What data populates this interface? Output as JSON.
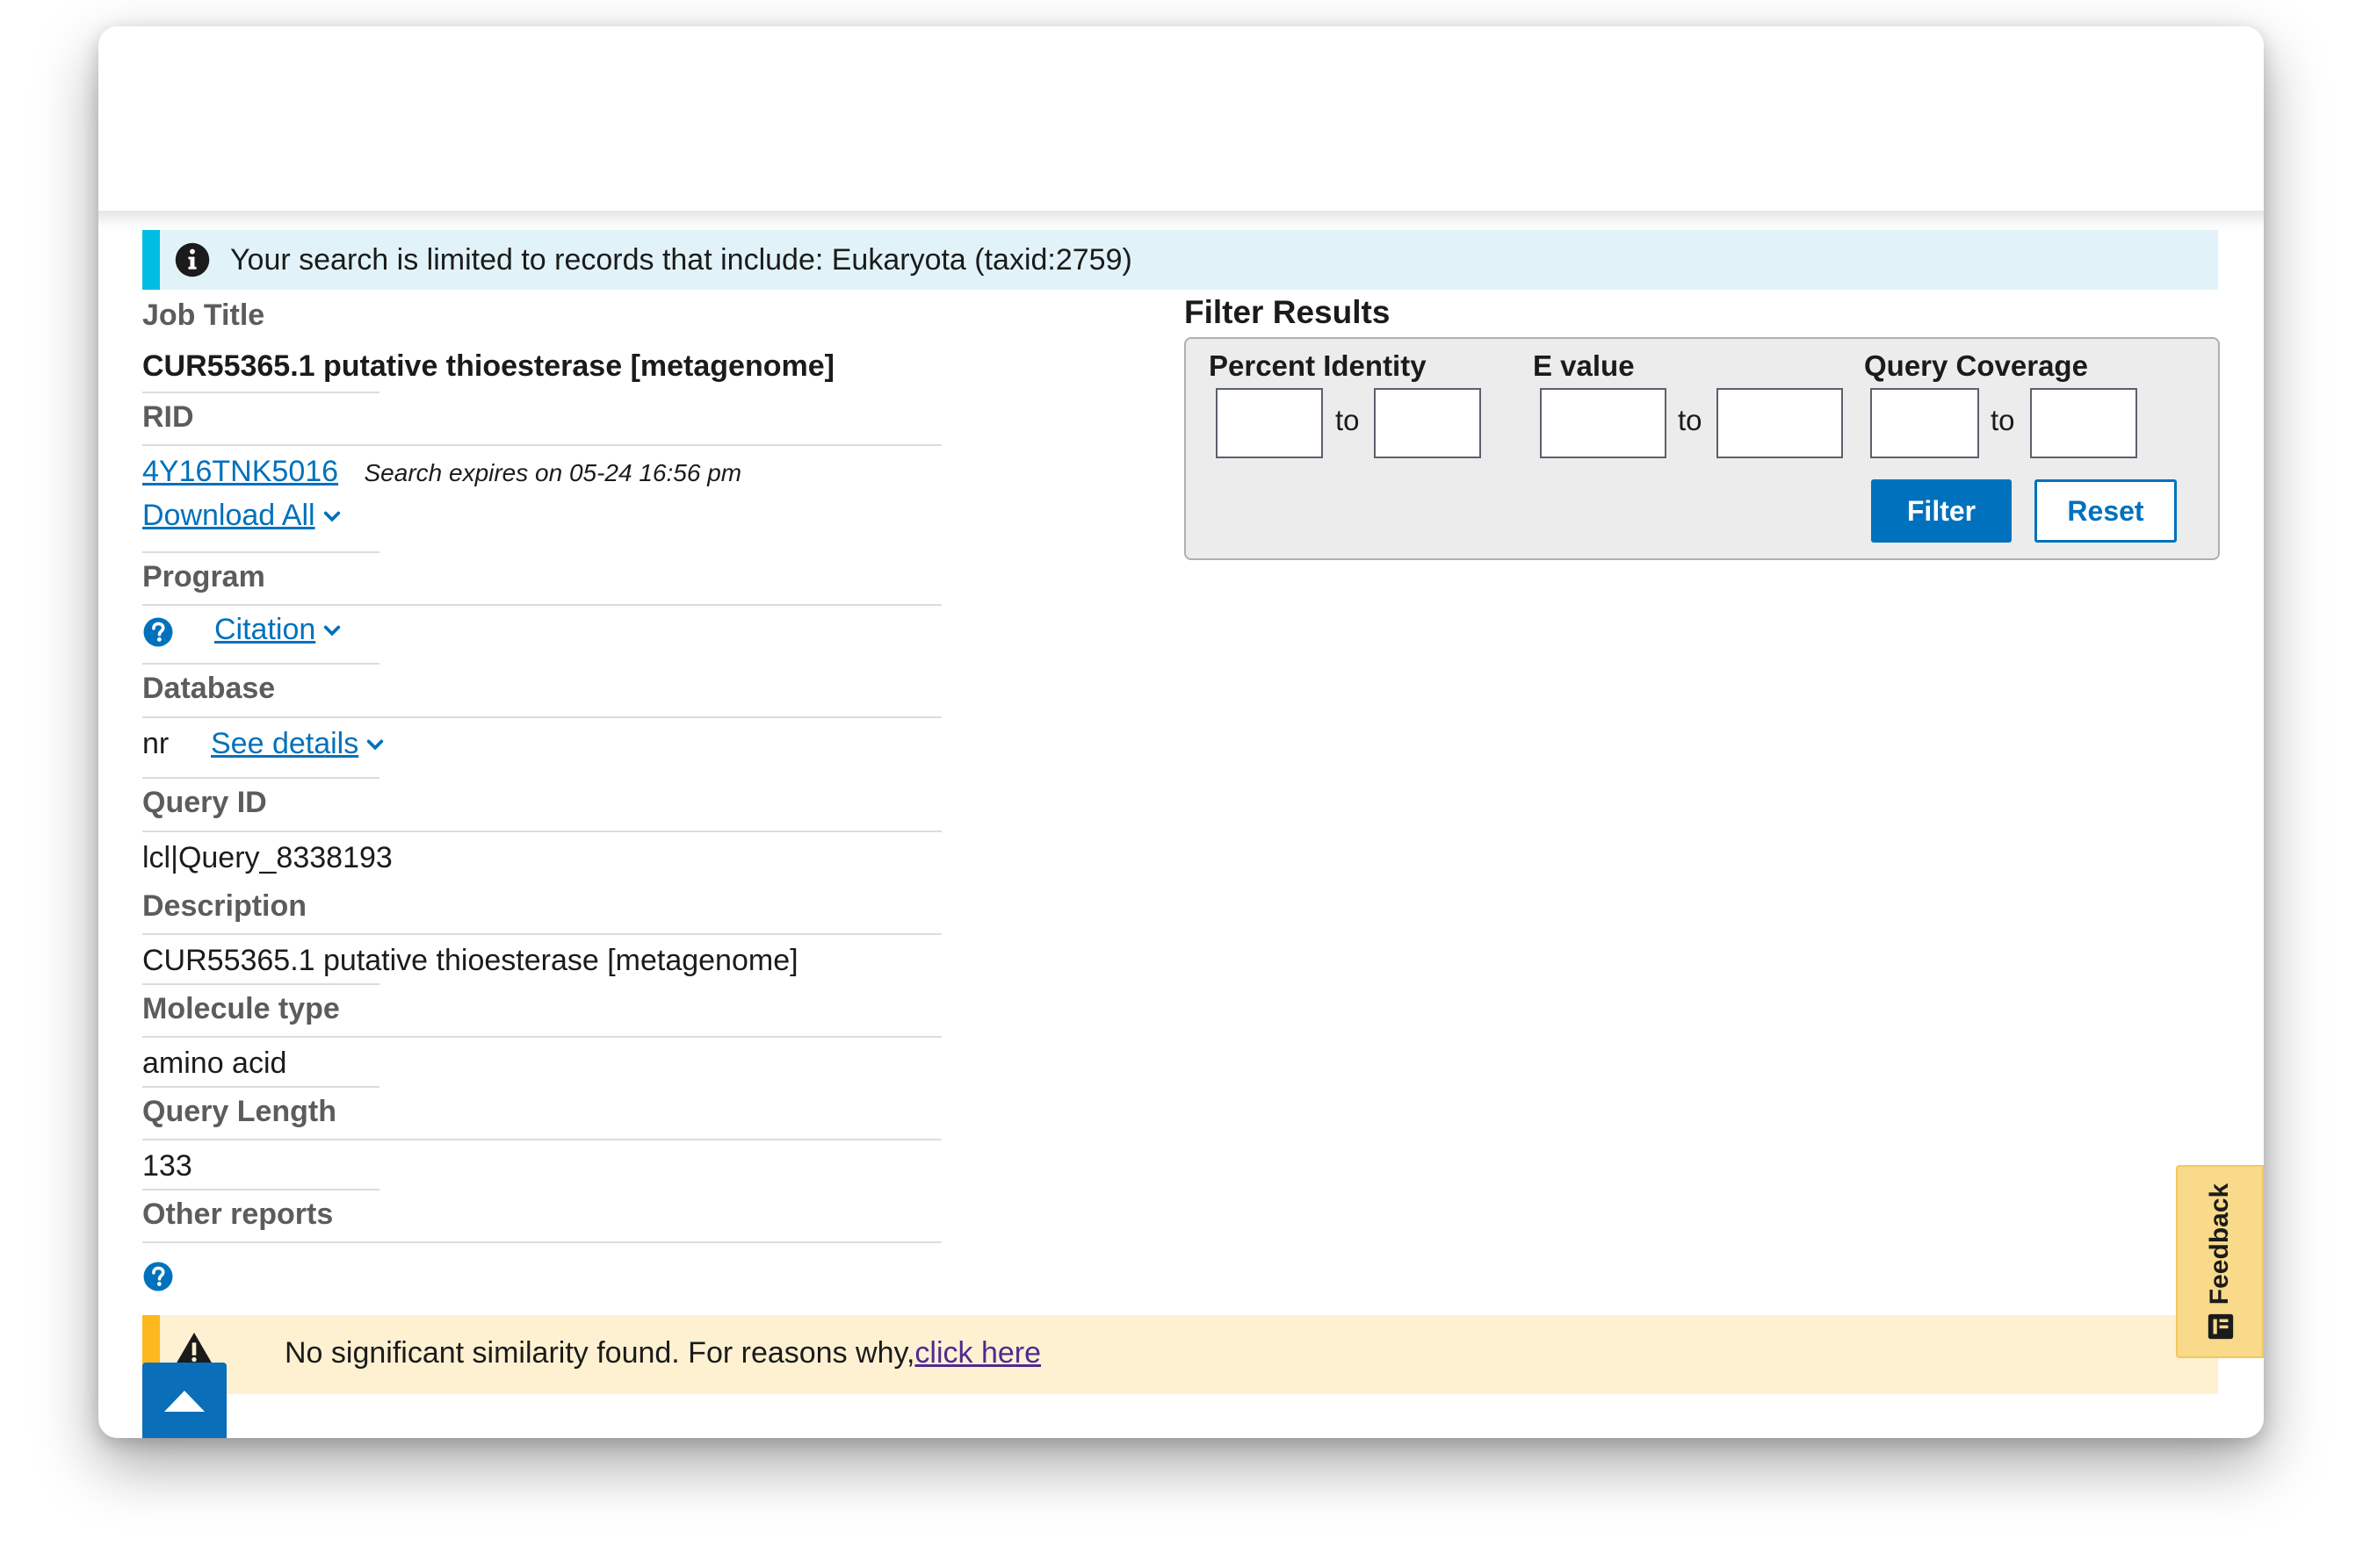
{
  "info_banner": {
    "message": "Your search is limited to records that include: Eukaryota (taxid:2759)"
  },
  "job": {
    "job_title_label": "Job Title",
    "job_title": "CUR55365.1 putative thioesterase [metagenome]",
    "rid_label": "RID",
    "rid": "4Y16TNK5016",
    "expires": "Search expires on 05-24 16:56 pm",
    "download_all": "Download All",
    "program_label": "Program",
    "citation": "Citation",
    "database_label": "Database",
    "database": "nr",
    "see_details": "See details",
    "query_id_label": "Query ID",
    "query_id": "lcl|Query_8338193",
    "description_label": "Description",
    "description": "CUR55365.1 putative thioesterase [metagenome]",
    "molecule_type_label": "Molecule type",
    "molecule_type": "amino acid",
    "query_length_label": "Query Length",
    "query_length": "133",
    "other_reports_label": "Other reports"
  },
  "filter": {
    "title": "Filter Results",
    "percent_identity_label": "Percent Identity",
    "evalue_label": "E value",
    "query_coverage_label": "Query Coverage",
    "to": "to",
    "filter_button": "Filter",
    "reset_button": "Reset"
  },
  "warning": {
    "message": "No significant similarity found. For reasons why,",
    "link": "click here"
  },
  "feedback": {
    "label": "Feedback"
  },
  "colors": {
    "link": "#0071bc",
    "info_accent": "#00bde3",
    "info_bg": "#e1f3f8",
    "warn_accent": "#fdb81e",
    "warn_bg": "#fef1d2",
    "primary_button": "#0071bc",
    "feedback_bg": "#f9d98a"
  },
  "icons": [
    "info-icon",
    "help-icon",
    "chevron-down-icon",
    "warning-icon",
    "arrow-up-icon",
    "feedback-icon"
  ]
}
